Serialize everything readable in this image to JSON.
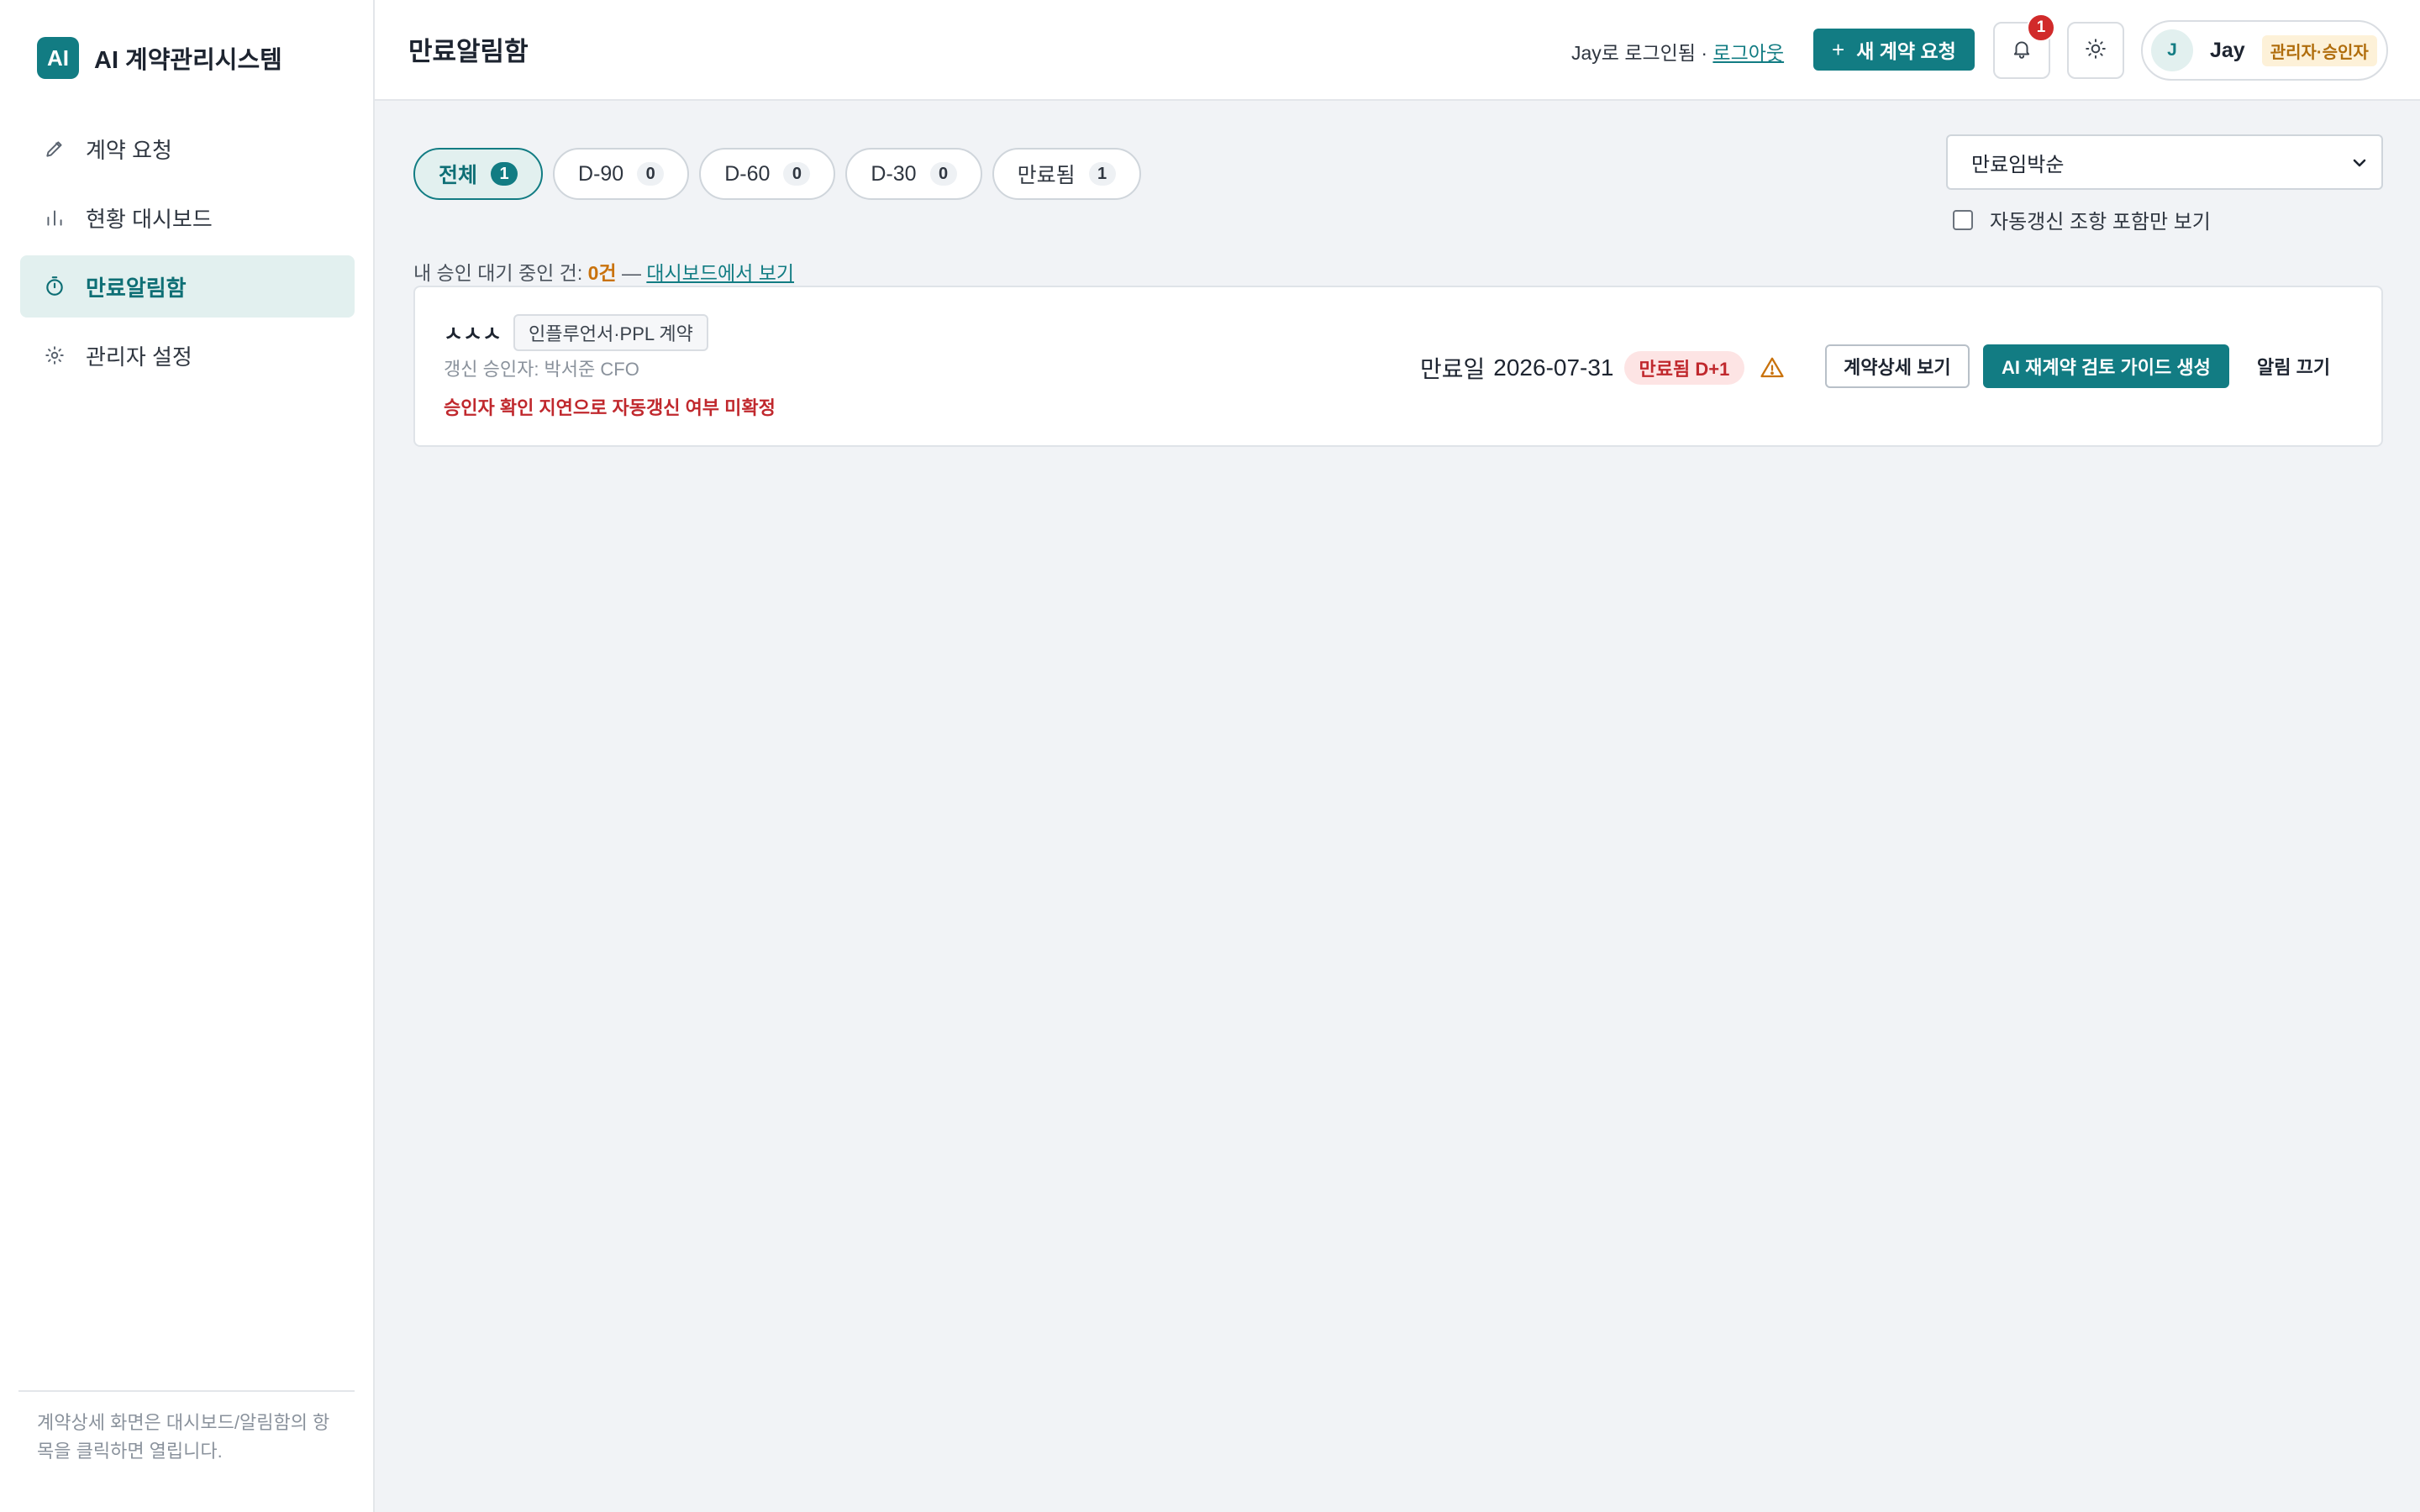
{
  "brand": {
    "logo_text": "AI",
    "name": "AI 계약관리시스템"
  },
  "sidebar": {
    "items": [
      {
        "label": "계약 요청",
        "icon": "pencil-icon"
      },
      {
        "label": "현황 대시보드",
        "icon": "bar-chart-icon"
      },
      {
        "label": "만료알림함",
        "icon": "timer-icon",
        "active": true
      },
      {
        "label": "관리자 설정",
        "icon": "gear-icon"
      }
    ],
    "footer_note": "계약상세 화면은 대시보드/알림함의 항목을 클릭하면 열립니다."
  },
  "header": {
    "page_title": "만료알림함",
    "login_text": "Jay로 로그인됨 · ",
    "logout_label": "로그아웃",
    "new_request_label": "새 계약 요청",
    "notification_count": "1",
    "user": {
      "avatar_initial": "J",
      "name": "Jay",
      "role": "관리자·승인자"
    }
  },
  "filters": {
    "tabs": [
      {
        "label": "전체",
        "count": "1",
        "active": true
      },
      {
        "label": "D-90",
        "count": "0"
      },
      {
        "label": "D-60",
        "count": "0"
      },
      {
        "label": "D-30",
        "count": "0"
      },
      {
        "label": "만료됨",
        "count": "1"
      }
    ],
    "sort_selected": "만료임박순",
    "auto_renew_only_label": "자동갱신 조항 포함만 보기"
  },
  "pending": {
    "prefix": "내 승인 대기 중인 건: ",
    "count_text": "0건",
    "dash": " — ",
    "link_label": "대시보드에서 보기"
  },
  "contracts": [
    {
      "name": "ㅅㅅㅅ",
      "type": "인플루언서·PPL 계약",
      "approver": "갱신 승인자: 박서준 CFO",
      "warning": "승인자 확인 지연으로 자동갱신 여부 미확정",
      "expiry_label": "만료일",
      "expiry_date": "2026-07-31",
      "status": "만료됨 D+1",
      "actions": {
        "detail": "계약상세 보기",
        "ai_guide": "AI 재계약 검토 가이드 생성",
        "mute": "알림 끄기"
      }
    }
  ],
  "colors": {
    "brand": "#127c83",
    "expired_text": "#c0282d",
    "expired_bg": "#fde4e4",
    "warning": "#c9720c",
    "notif_badge": "#d12a2a"
  }
}
